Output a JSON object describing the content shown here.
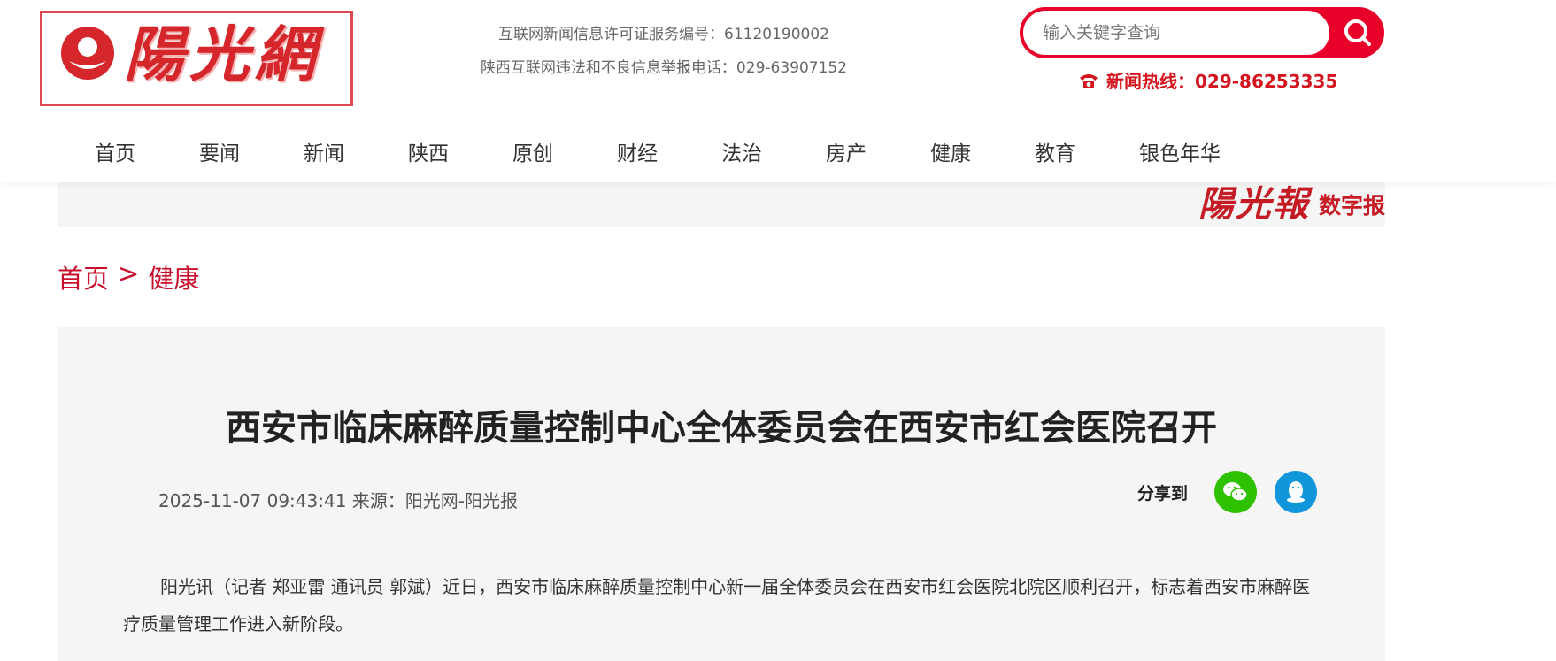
{
  "header": {
    "logo_text": "陽光網",
    "license_line1": "互联网新闻信息许可证服务编号：61120190002",
    "license_line2": "陕西互联网违法和不良信息举报电话：029-63907152",
    "search_placeholder": "输入关键字查询",
    "hotline": "新闻热线：029-86253335"
  },
  "nav": {
    "items": [
      "首页",
      "要闻",
      "新闻",
      "陕西",
      "原创",
      "财经",
      "法治",
      "房产",
      "健康",
      "教育",
      "银色年华"
    ]
  },
  "banner": {
    "epaper_logo": "陽光報",
    "epaper_label": "数字报"
  },
  "breadcrumb": {
    "home": "首页",
    "separator": ">",
    "current": "健康"
  },
  "article": {
    "title": "西安市临床麻醉质量控制中心全体委员会在西安市红会医院召开",
    "meta": "2025-11-07 09:43:41 来源：阳光网-阳光报",
    "share_label": "分享到",
    "paragraph1": "阳光讯（记者 郑亚雷 通讯员 郭斌）近日，西安市临床麻醉质量控制中心新一届全体委员会在西安市红会医院北院区顺利召开，标志着西安市麻醉医疗质量管理工作进入新阶段。"
  },
  "colors": {
    "brand_red": "#d4262b",
    "search_red": "#e8002a",
    "wechat_green": "#2dc100",
    "qq_blue": "#1296db"
  },
  "icons": {
    "search": "search-icon",
    "phone": "phone-icon",
    "wechat": "wechat-icon",
    "qq": "qq-icon"
  }
}
